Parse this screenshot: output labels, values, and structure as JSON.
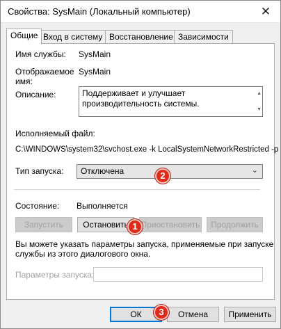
{
  "window": {
    "title": "Свойства: SysMain (Локальный компьютер)",
    "close_glyph": "✕"
  },
  "tabs": [
    {
      "label": "Общие"
    },
    {
      "label": "Вход в систему"
    },
    {
      "label": "Восстановление"
    },
    {
      "label": "Зависимости"
    }
  ],
  "general": {
    "service_name_label": "Имя службы:",
    "service_name_value": "SysMain",
    "display_name_label_1": "Отображаемое",
    "display_name_label_2": "имя:",
    "display_name_value": "SysMain",
    "description_label": "Описание:",
    "description_text": "Поддерживает и улучшает производительность системы.",
    "executable_label": "Исполняемый файл:",
    "executable_path": "C:\\WINDOWS\\system32\\svchost.exe -k LocalSystemNetworkRestricted -p",
    "startup_type_label": "Тип запуска:",
    "startup_type_value": "Отключена",
    "status_label": "Состояние:",
    "status_value": "Выполняется",
    "buttons": {
      "start": "Запустить",
      "stop": "Остановить",
      "pause": "Приостановить",
      "resume": "Продолжить"
    },
    "hint_text_1": "Вы можете указать параметры запуска, применяемые при запуске",
    "hint_text_2": "службы из этого диалогового окна.",
    "start_params_label": "Параметры запуска:",
    "start_params_value": ""
  },
  "footer": {
    "ok": "ОК",
    "cancel": "Отмена",
    "apply": "Применить"
  },
  "callouts": [
    "1",
    "2",
    "3"
  ],
  "colors": {
    "callout": "#e02b1a",
    "default_button_border": "#0078d7",
    "disabled_text": "#a0a0a0"
  }
}
